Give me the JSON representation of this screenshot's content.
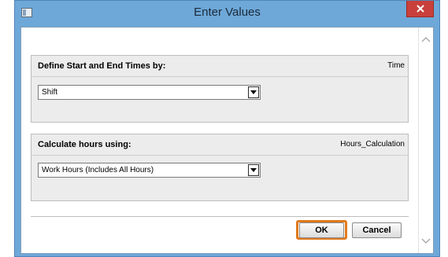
{
  "window": {
    "title": "Enter Values",
    "close_icon": "close-icon",
    "app_icon": "window-icon",
    "colors": {
      "frame": "#6ea8d8",
      "close": "#c9403a",
      "highlight": "#e07a1f"
    }
  },
  "sections": [
    {
      "title": "Define Start and End Times by:",
      "tag": "Time",
      "selected": "Shift"
    },
    {
      "title": "Calculate hours using:",
      "tag": "Hours_Calculation",
      "selected": "Work Hours (Includes All Hours)"
    }
  ],
  "buttons": {
    "ok": "OK",
    "cancel": "Cancel"
  },
  "icons": {
    "dropdown": "chevron-down-icon",
    "scroll_up": "chevron-up-icon",
    "scroll_down": "chevron-down-icon"
  }
}
